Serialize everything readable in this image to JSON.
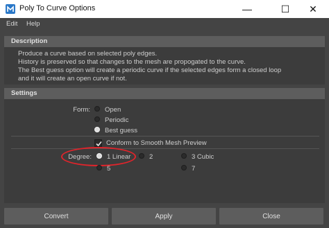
{
  "window": {
    "title": "Poly To Curve Options",
    "minimize_glyph": "—",
    "maximize_glyph": "☐",
    "close_glyph": "✕"
  },
  "menu": [
    "Edit",
    "Help"
  ],
  "description": {
    "header": "Description",
    "lines": [
      "Produce a curve based on selected poly edges.",
      "History is preserved so that changes to the mesh are propogated to the curve.",
      "The Best guess option will create a periodic curve if the selected edges form a closed loop",
      "and it will create an open curve if not."
    ]
  },
  "settings": {
    "header": "Settings",
    "form": {
      "label": "Form:",
      "options": [
        "Open",
        "Periodic",
        "Best guess"
      ],
      "selected": "Best guess"
    },
    "conform": {
      "label": "Conform to Smooth Mesh Preview",
      "checked": true
    },
    "degree": {
      "label": "Degree:",
      "options": [
        "1 Linear",
        "2",
        "3 Cubic",
        "5",
        "7"
      ],
      "selected": "1 Linear"
    }
  },
  "buttons": [
    "Convert",
    "Apply",
    "Close"
  ],
  "colors": {
    "background": "#444444",
    "panel": "#3c3c3c",
    "header": "#5d5d5d",
    "highlight_ring": "#e0242b"
  }
}
